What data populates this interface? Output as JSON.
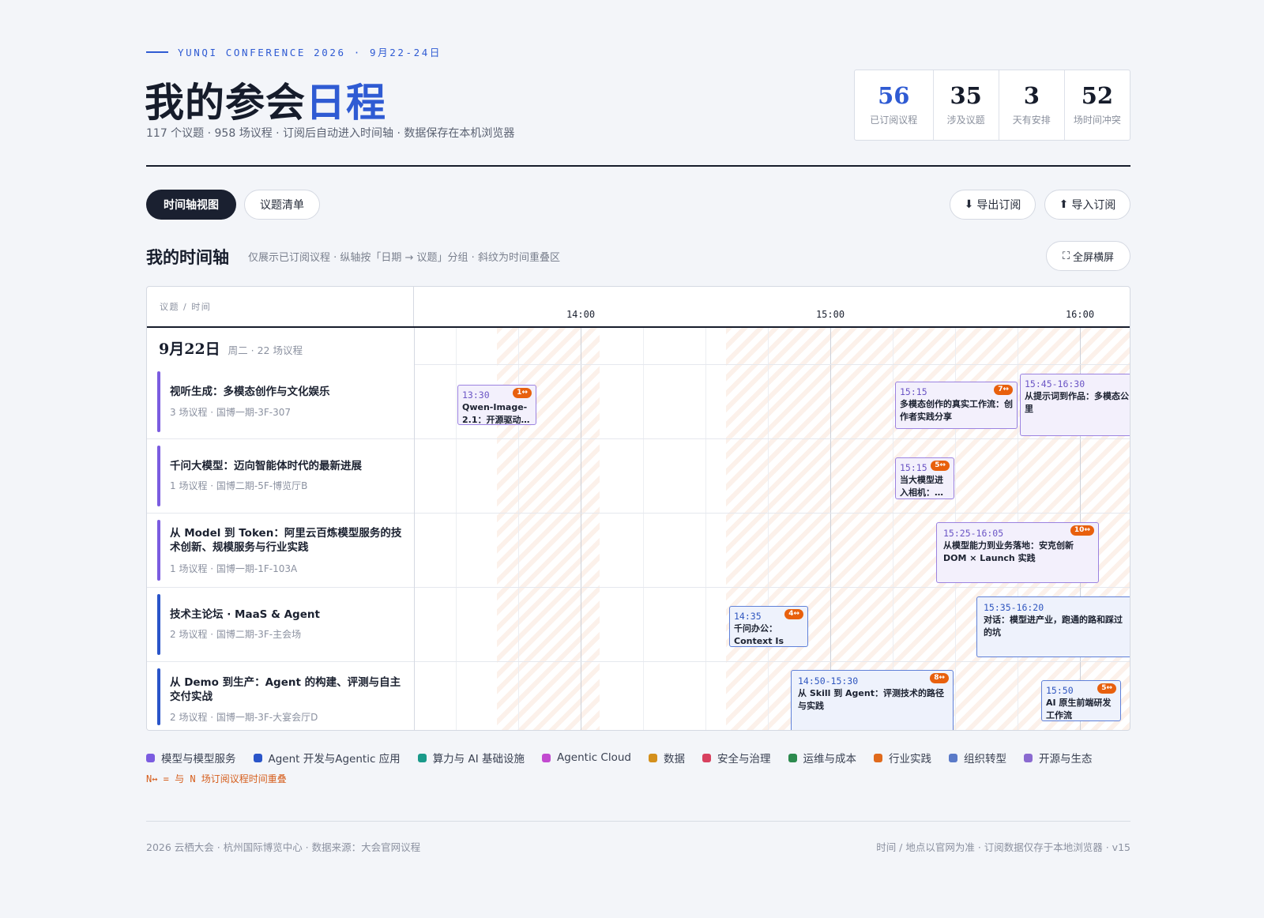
{
  "header": {
    "eyebrow": "YUNQI CONFERENCE 2026 · 9月22-24日",
    "title_main": "我的参会",
    "title_accent": "日程",
    "subtitle": "117 个议题 · 958 场议程 · 订阅后自动进入时间轴 · 数据保存在本机浏览器"
  },
  "stats": [
    {
      "value": "56",
      "label": "已订阅议程"
    },
    {
      "value": "35",
      "label": "涉及议题"
    },
    {
      "value": "3",
      "label": "天有安排"
    },
    {
      "value": "52",
      "label": "场时间冲突"
    }
  ],
  "toolbar": {
    "tab_timeline": "时间轴视图",
    "tab_list": "议题清单",
    "export_label": "导出订阅",
    "import_label": "导入订阅",
    "fullscreen_label": "全屏横屏"
  },
  "section": {
    "title": "我的时间轴",
    "desc": "仅展示已订阅议程 · 纵轴按「日期 → 议题」分组 · 斜纹为时间重叠区"
  },
  "timeline": {
    "header_left": "议题 / 时间",
    "ticks": [
      "14:00",
      "15:00",
      "16:00"
    ],
    "date_label": "9月22日",
    "date_meta": "周二 · 22 场议程",
    "tracks": [
      {
        "name": "视听生成：多模态创作与文化娱乐",
        "meta": "3 场议程 · 国博一期-3F-307",
        "color": "#7b5ce0"
      },
      {
        "name": "千问大模型：迈向智能体时代的最新进展",
        "meta": "1 场议程 · 国博二期-5F-博览厅B",
        "color": "#7b5ce0"
      },
      {
        "name": "从 Model 到 Token：阿里云百炼模型服务的技术创新、规模服务与行业实践",
        "meta": "1 场议程 · 国博一期-1F-103A",
        "color": "#7b5ce0"
      },
      {
        "name": "技术主论坛 · MaaS & Agent",
        "meta": "2 场议程 · 国博二期-3F-主会场",
        "color": "#2a55c9"
      },
      {
        "name": "从 Demo 到生产：Agent 的构建、评测与自主交付实战",
        "meta": "2 场议程 · 国博一期-3F-大宴会厅D",
        "color": "#2a55c9"
      }
    ],
    "cards": [
      {
        "time": "13:30",
        "title": "Qwen-Image-2.1：开源驱动…",
        "badge": "1↔"
      },
      {
        "time": "15:15",
        "title": "多模态创作的真实工作流：创作者实践分享",
        "badge": "7↔"
      },
      {
        "time": "15:45-16:30",
        "title": "从提示词到作品：多模态公里",
        "badge": ""
      },
      {
        "time": "15:15",
        "title": "当大模型进入相机：…",
        "badge": "5↔"
      },
      {
        "time": "15:25-16:05",
        "title": "从模型能力到业务落地：安克创新 DOM × Launch 实践",
        "badge": "10↔"
      },
      {
        "time": "14:35",
        "title": "千问办公：Context Is All…",
        "badge": "4↔"
      },
      {
        "time": "15:35-16:20",
        "title": "对话：模型进产业，跑通的路和踩过的坑",
        "badge": ""
      },
      {
        "time": "14:50-15:30",
        "title": "从 Skill 到 Agent：评测技术的路径与实践",
        "badge": "8↔"
      },
      {
        "time": "15:50",
        "title": "AI 原生前端研发工作流",
        "badge": "5↔"
      }
    ]
  },
  "legend": {
    "items": [
      {
        "label": "模型与模型服务",
        "color": "#7b5ce0"
      },
      {
        "label": "Agent 开发与Agentic 应用",
        "color": "#2a55c9"
      },
      {
        "label": "算力与 AI 基础设施",
        "color": "#1a9a8a"
      },
      {
        "label": "Agentic Cloud",
        "color": "#c24ad0"
      },
      {
        "label": "数据",
        "color": "#d4901c"
      },
      {
        "label": "安全与治理",
        "color": "#d8415f"
      },
      {
        "label": "运维与成本",
        "color": "#2c8a4e"
      },
      {
        "label": "行业实践",
        "color": "#e06a1c"
      },
      {
        "label": "组织转型",
        "color": "#5a7ac8"
      },
      {
        "label": "开源与生态",
        "color": "#8a6ad0"
      }
    ],
    "note": "N↔ = 与 N 场订阅议程时间重叠"
  },
  "footer": {
    "left": "2026 云栖大会 · 杭州国际博览中心 · 数据来源：大会官网议程",
    "right": "时间 / 地点以官网为准 · 订阅数据仅存于本地浏览器 · v15"
  }
}
